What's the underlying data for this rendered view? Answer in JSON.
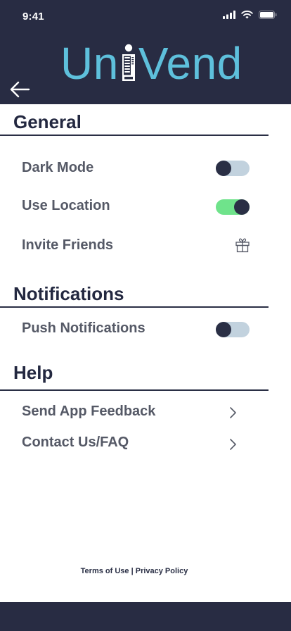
{
  "status_bar": {
    "time": "9:41"
  },
  "brand": {
    "left": "Un",
    "right": "Vend"
  },
  "sections": {
    "general": {
      "title": "General",
      "dark_mode": {
        "label": "Dark Mode",
        "enabled": false
      },
      "use_location": {
        "label": "Use Location",
        "enabled": true
      },
      "invite_friends": {
        "label": "Invite Friends",
        "icon": "gift-icon"
      }
    },
    "notifications": {
      "title": "Notifications",
      "push": {
        "label": "Push Notifications",
        "enabled": false
      }
    },
    "help": {
      "title": "Help",
      "feedback": {
        "label": "Send App Feedback",
        "icon": "chevron-right-icon"
      },
      "contact": {
        "label": "Contact Us/FAQ",
        "icon": "chevron-right-icon"
      }
    }
  },
  "footer": {
    "terms": "Terms of Use",
    "separator": " | ",
    "privacy": "Privacy Policy"
  },
  "colors": {
    "header": "#282c43",
    "brand": "#5ec0dc",
    "toggle_on": "#6fe38b",
    "toggle_off": "#c2d2de"
  }
}
